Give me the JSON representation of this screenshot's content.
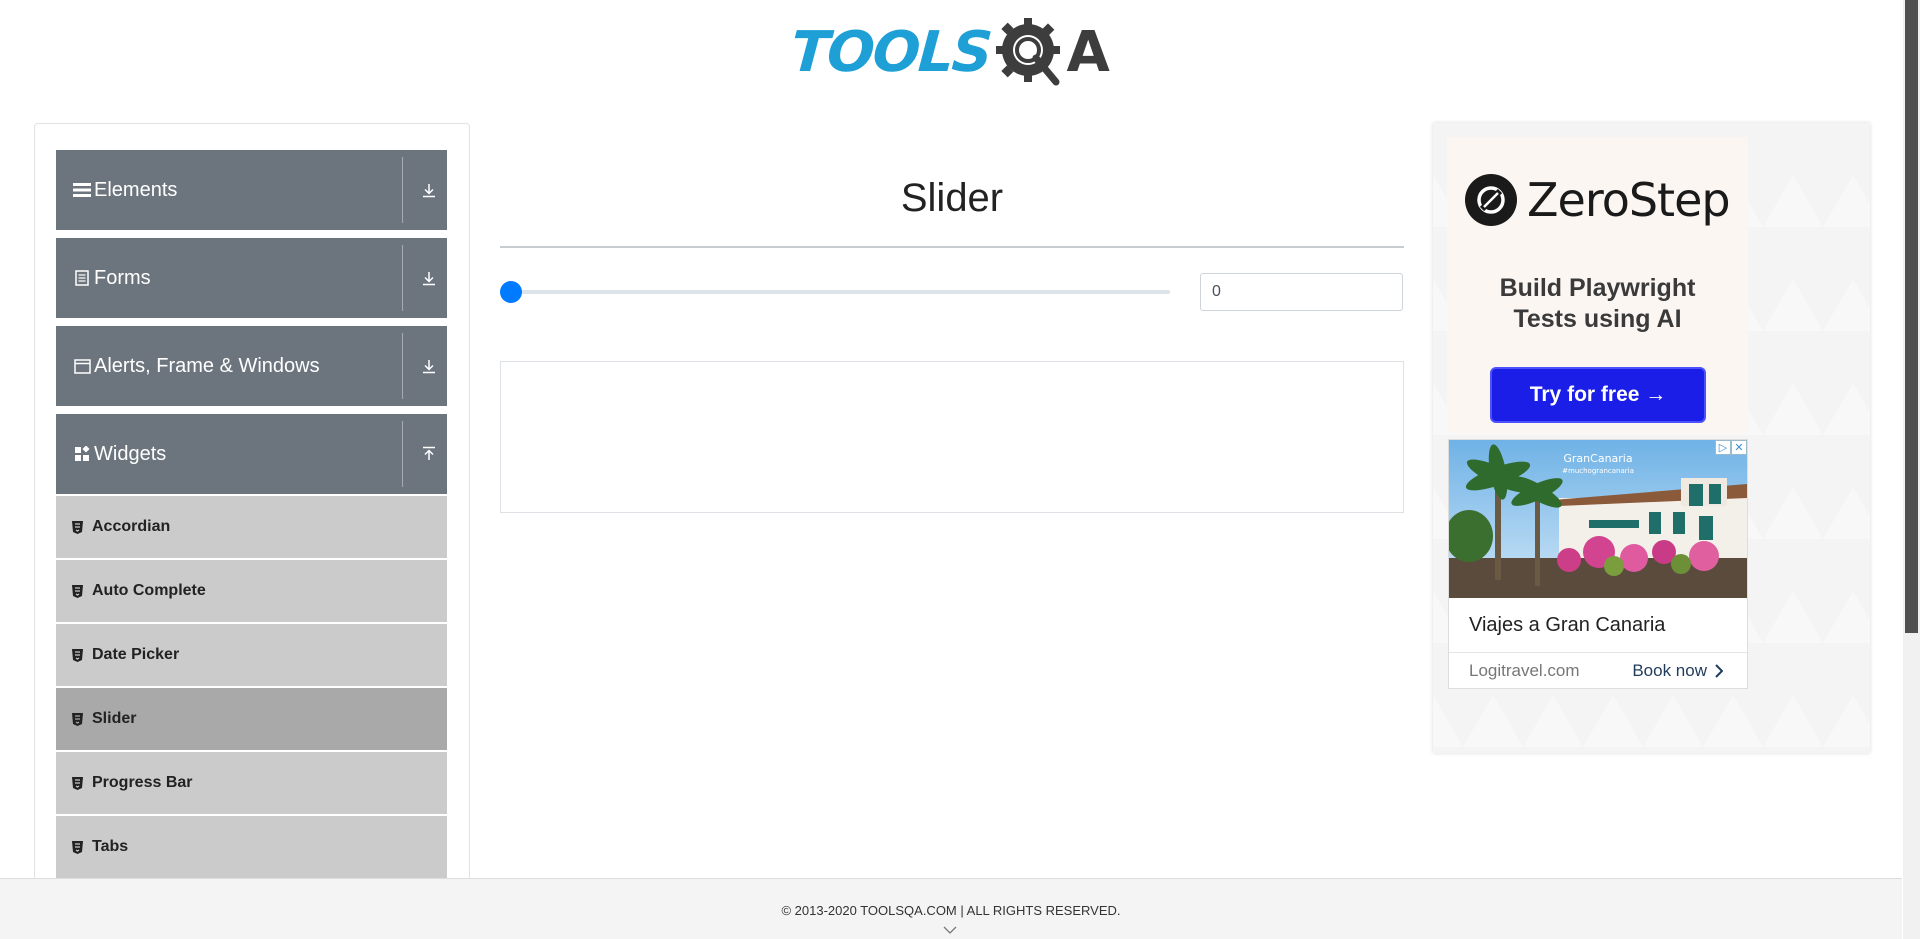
{
  "header": {
    "logo_tools": "TOOLS",
    "logo_a": "A"
  },
  "sidebar": {
    "groups": [
      {
        "label": "Elements",
        "icon": "list-icon",
        "arrow": "download-arrow-icon"
      },
      {
        "label": "Forms",
        "icon": "document-icon",
        "arrow": "download-arrow-icon"
      },
      {
        "label": "Alerts, Frame & Windows",
        "icon": "window-icon",
        "arrow": "download-arrow-icon"
      },
      {
        "label": "Widgets",
        "icon": "widgets-icon",
        "arrow": "upload-arrow-icon"
      }
    ],
    "items": [
      {
        "label": "Accordian"
      },
      {
        "label": "Auto Complete"
      },
      {
        "label": "Date Picker"
      },
      {
        "label": "Slider",
        "active": true
      },
      {
        "label": "Progress Bar"
      },
      {
        "label": "Tabs"
      }
    ]
  },
  "main": {
    "title": "Slider",
    "slider": {
      "value": "0",
      "fraction": 0.0
    }
  },
  "ad": {
    "brand": "ZeroStep",
    "tagline_line1": "Build Playwright",
    "tagline_line2": "Tests using AI",
    "button": "Try for free →",
    "photo_caption": "GranCanaria",
    "photo_subcaption": "#muchograncanaria",
    "headline": "Viajes a Gran Canaria",
    "domain": "Logitravel.com",
    "cta": "Book now"
  },
  "footer": {
    "text": "© 2013-2020 TOOLSQA.COM | ALL RIGHTS RESERVED."
  },
  "colors": {
    "accent": "#007bff",
    "nav_header": "#6c757d",
    "nav_item": "#cbcbcb",
    "nav_item_active": "#a9a9a9",
    "logo_blue": "#1ea0d6"
  }
}
